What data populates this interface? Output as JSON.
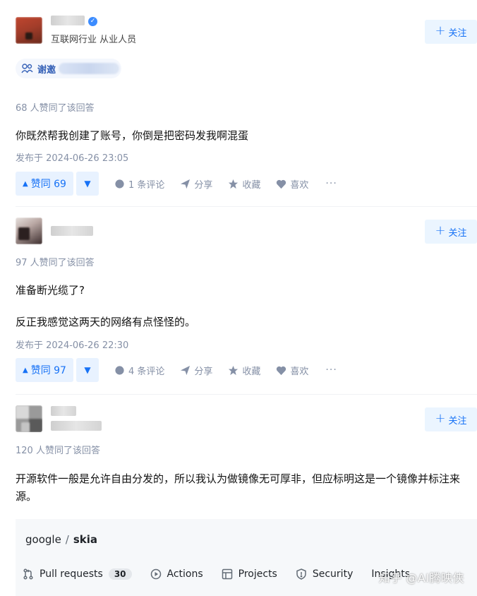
{
  "answers": [
    {
      "headline": "互联网行业 从业人员",
      "follow_label": "关注",
      "thanks_label": "谢邀",
      "votes_line": "68 人赞同了该回答",
      "content": [
        "你既然帮我创建了账号，你倒是把密码发我啊混蛋"
      ],
      "time": "发布于 2024-06-26 23:05",
      "vote_label": "赞同 69",
      "comments": "1 条评论",
      "share": "分享",
      "collect": "收藏",
      "like": "喜欢",
      "more": "···"
    },
    {
      "follow_label": "关注",
      "votes_line": "97 人赞同了该回答",
      "content": [
        "准备断光缆了?",
        "反正我感觉这两天的网络有点怪怪的。"
      ],
      "time": "发布于 2024-06-26 22:30",
      "vote_label": "赞同 97",
      "comments": "4 条评论",
      "share": "分享",
      "collect": "收藏",
      "like": "喜欢",
      "more": "···"
    },
    {
      "follow_label": "关注",
      "votes_line": "120 人赞同了该回答",
      "content": [
        "开源软件一般是允许自由分发的，所以我认为做镜像无可厚非，但应标明这是一个镜像并标注来源。"
      ]
    }
  ],
  "github": {
    "owner": "google",
    "separator": "/",
    "repo": "skia",
    "tabs": [
      {
        "label": "Pull requests",
        "icon": "pull-request-icon",
        "count": "30"
      },
      {
        "label": "Actions",
        "icon": "play-circle-icon"
      },
      {
        "label": "Projects",
        "icon": "table-icon"
      },
      {
        "label": "Security",
        "icon": "shield-icon"
      },
      {
        "label": "Insights",
        "icon": "graph-icon"
      }
    ]
  },
  "watermark": "知乎 @AI腾映侠",
  "colors": {
    "accent": "#1772f6",
    "accent_bg": "#ebf5ff",
    "meta": "#8590a6"
  }
}
